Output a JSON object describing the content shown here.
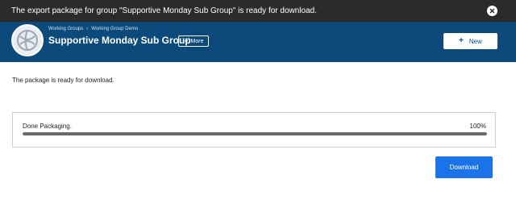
{
  "notification": {
    "message": "The export package for group \"Supportive Monday Sub Group\" is ready for download.",
    "close_icon": "close-icon"
  },
  "header": {
    "breadcrumbs": [
      "Working Groups",
      "Working Group Demo"
    ],
    "title": "Supportive Monday Sub Group",
    "more_label": "More",
    "new_label": "New",
    "logo_icon": "globe-icon",
    "background_color": "#0b4a7a"
  },
  "main": {
    "status_text": "The package is ready for download.",
    "progress": {
      "label": "Done Packaging.",
      "percent_text": "100%",
      "fraction": 1.0
    },
    "download_label": "Download",
    "accent_color": "#1a73e8"
  }
}
